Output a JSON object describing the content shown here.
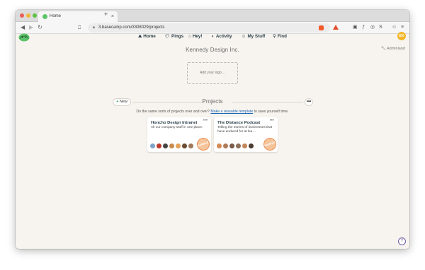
{
  "browser": {
    "tab_title": "Home",
    "tab_close": "×",
    "new_tab": "+",
    "url": "3.basecamp.com/3308029/projects",
    "back": "◀",
    "forward": "▶",
    "reload": "↻"
  },
  "nav": {
    "home": "Home",
    "pings": "Pings",
    "hey": "Hey!",
    "activity": "Activity",
    "my_stuff": "My Stuff",
    "find": "Find",
    "avatar_initials": "EK"
  },
  "adminland": "Adminland",
  "company_name": "Kennedy Design Inc.",
  "logo_placeholder": "Add your logo…",
  "projects": {
    "title": "Projects",
    "new_label": "New",
    "menu_label": "•••",
    "hint_prefix": "Do the same sorts of projects over and over?",
    "hint_link": "Make a reusable template",
    "hint_suffix": "to save yourself time.",
    "cards": [
      {
        "title": "Honcho Design Intranet",
        "description": "All our company stuff in one place.",
        "more": "•••",
        "badge": "SAMPLE",
        "people_colors": [
          "#7fa3c7",
          "#c0392b",
          "#444444",
          "#c98a4b",
          "#e5a35a",
          "#6b4a2f",
          "#a0785a"
        ]
      },
      {
        "title": "The Distance Podcast",
        "description": "Telling the stories of businesses that have endured for at lea…",
        "more": "•••",
        "badge": "SAMPLE",
        "people_colors": [
          "#d48a55",
          "#b07a58",
          "#7a5a48",
          "#8c6f5a",
          "#c2875b",
          "#4a3a2f"
        ]
      }
    ]
  },
  "help": "?",
  "colors": {
    "page_bg": "#f7f4ef",
    "nav_text": "#283c46",
    "link": "#1f66b5",
    "avatar": "#f3b72b",
    "sample_badge": "#ec8b4e"
  }
}
